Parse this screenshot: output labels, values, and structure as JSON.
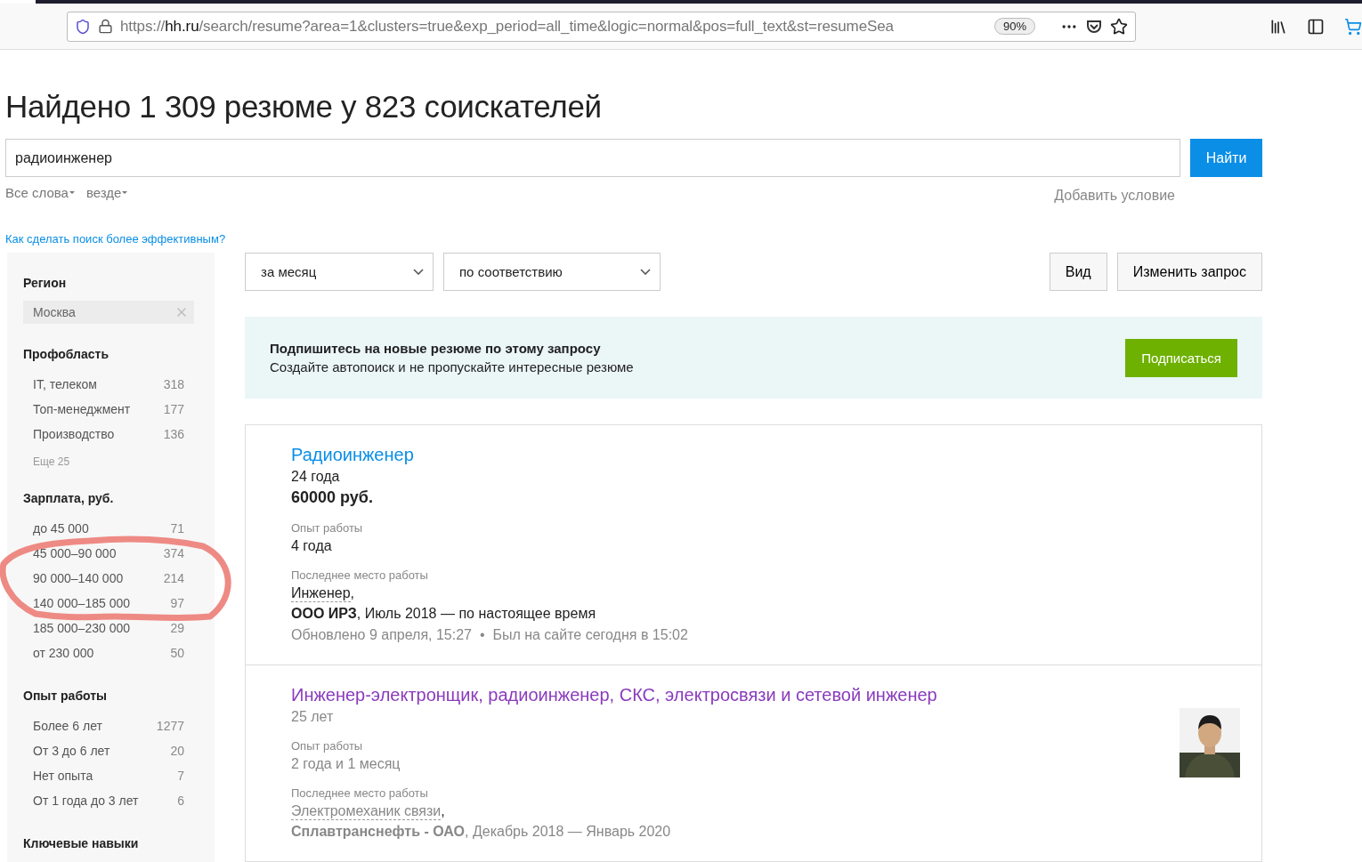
{
  "browser": {
    "url_prefix": "https://",
    "url_host": "hh.ru",
    "url_rest": "/search/resume?area=1&clusters=true&exp_period=all_time&logic=normal&pos=full_text&st=resumeSea",
    "zoom": "90%"
  },
  "heading": "Найдено 1 309 резюме у 823 соискателей",
  "search": {
    "value": "радиоинженер",
    "button": "Найти"
  },
  "search_options": [
    "Все слова",
    "везде"
  ],
  "add_condition": "Добавить условие",
  "help_link": "Как сделать поиск более эффективным?",
  "filters": [
    {
      "title": "Регион",
      "kind": "tag",
      "tag": "Москва"
    },
    {
      "title": "Профобласть",
      "kind": "list",
      "items": [
        {
          "label": "IT, телеком",
          "count": "318"
        },
        {
          "label": "Топ-менеджмент",
          "count": "177"
        },
        {
          "label": "Производство",
          "count": "136"
        }
      ],
      "more": "Еще 25"
    },
    {
      "title": "Зарплата, руб.",
      "kind": "list",
      "items": [
        {
          "label": "до 45 000",
          "count": "71"
        },
        {
          "label": "45 000–90 000",
          "count": "374"
        },
        {
          "label": "90 000–140 000",
          "count": "214"
        },
        {
          "label": "140 000–185 000",
          "count": "97"
        },
        {
          "label": "185 000–230 000",
          "count": "29"
        },
        {
          "label": "от 230 000",
          "count": "50"
        }
      ]
    },
    {
      "title": "Опыт работы",
      "kind": "list",
      "items": [
        {
          "label": "Более 6 лет",
          "count": "1277"
        },
        {
          "label": "От 3 до 6 лет",
          "count": "20"
        },
        {
          "label": "Нет опыта",
          "count": "7"
        },
        {
          "label": "От 1 года до 3 лет",
          "count": "6"
        }
      ]
    },
    {
      "title": "Ключевые навыки",
      "kind": "title"
    }
  ],
  "dropdowns": [
    "за месяц",
    "по соответствию"
  ],
  "buttons": [
    "Вид",
    "Изменить запрос"
  ],
  "subscribe": {
    "title": "Подпишитесь на новые резюме по этому запросу",
    "text": "Создайте автопоиск и не пропускайте интересные резюме",
    "button": "Подписаться"
  },
  "results": [
    {
      "title": "Радиоинженер",
      "visited": false,
      "age": "24 года",
      "salary": "60000 руб.",
      "experience_label": "Опыт работы",
      "experience": "4 года",
      "last_job_label": "Последнее место работы",
      "position": "Инженер",
      "position_suffix": ",",
      "company_line": "**ООО ИРЗ**, Июль 2018 — по настоящее время",
      "updated": "Обновлено 9 апреля, 15:27",
      "separator": "•",
      "online": "Был на сайте сегодня в 15:02",
      "photo": false
    },
    {
      "title": "Инженер-электронщик, радиоинженер, СКС, электросвязи и сетевой инженер",
      "visited": true,
      "age": "25 лет",
      "experience_label": "Опыт работы",
      "experience": "2 года и 1 месяц",
      "last_job_label": "Последнее место работы",
      "position": "Электромеханик связи",
      "position_suffix": ",",
      "company_line": "**Сплавтранснефть - ОАО**, Декабрь 2018 — Январь 2020",
      "photo": true
    }
  ]
}
